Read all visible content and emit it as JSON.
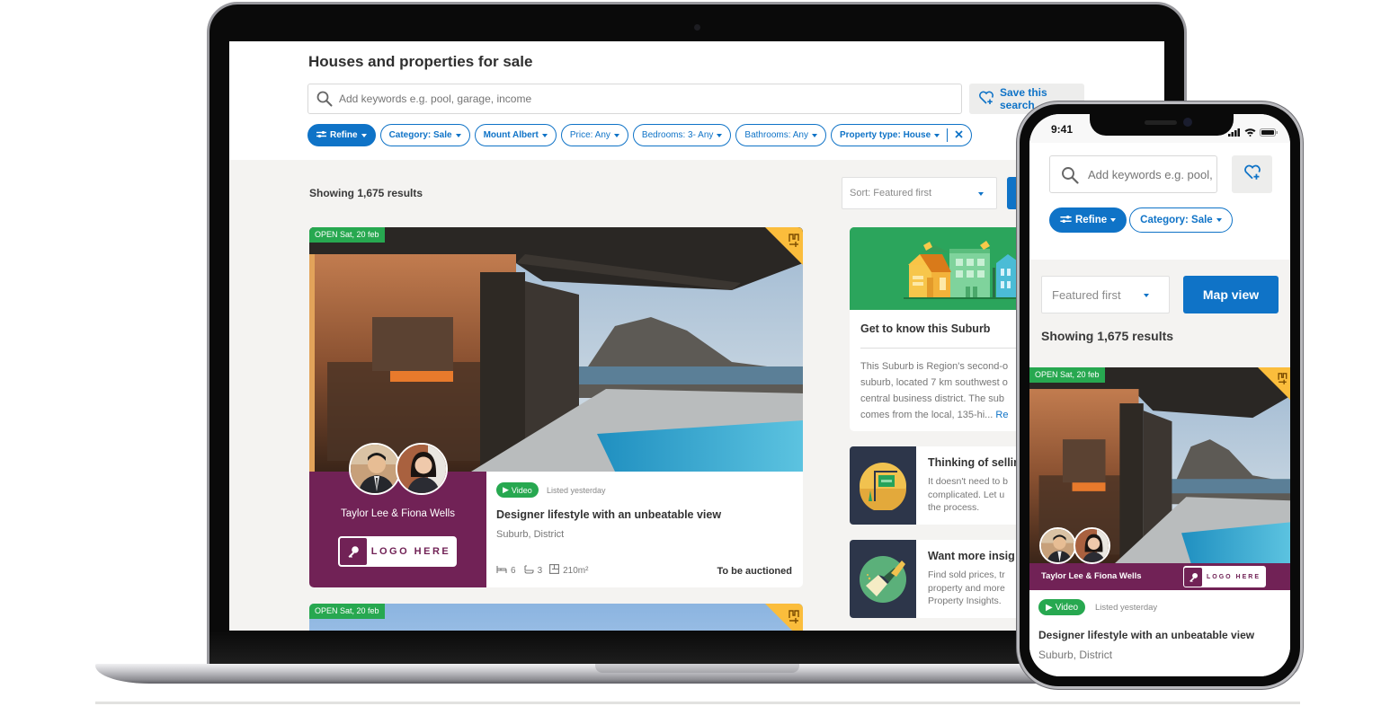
{
  "desktop": {
    "page_title": "Houses and properties for sale",
    "search": {
      "placeholder": "Add keywords e.g. pool, garage, income",
      "value": ""
    },
    "save_search_label": "Save this search",
    "filters": {
      "refine": "Refine",
      "category": "Category: Sale",
      "location": "Mount Albert",
      "price": "Price: Any",
      "bedrooms": "Bedrooms: 3- Any",
      "bathrooms": "Bathrooms: Any",
      "property_type": "Property type: House"
    },
    "results_count": "Showing 1,675 results",
    "sort": {
      "selected": "Sort: Featured first"
    },
    "listing": {
      "open_home": "OPEN Sat, 20 feb",
      "agent_names": "Taylor Lee & Fiona Wells",
      "agency_logo": "LOGO HERE",
      "video_badge": "Video",
      "listed": "Listed yesterday",
      "title": "Designer lifestyle with an unbeatable view",
      "location": "Suburb, District",
      "bedrooms": "6",
      "bathrooms": "3",
      "floor_area": "210m²",
      "sale_method": "To be auctioned"
    },
    "listing2": {
      "open_home": "OPEN Sat, 20 feb"
    },
    "suburb_card": {
      "title": "Get to know this Suburb",
      "lines": [
        "This Suburb is Region's second-o",
        "suburb, located 7 km southwest o",
        "central business district. The sub",
        "comes from the local, 135-hi... "
      ],
      "read_more": "Re"
    },
    "promos": [
      {
        "title": "Thinking of sellin",
        "lines": [
          "It doesn't need to b",
          "complicated. Let u",
          "the process."
        ]
      },
      {
        "title": "Want more insig",
        "lines": [
          "Find sold prices, tr",
          "property and more",
          "Property Insights."
        ]
      }
    ]
  },
  "mobile": {
    "status_time": "9:41",
    "search": {
      "placeholder": "Add keywords e.g. pool,",
      "value": ""
    },
    "filters": {
      "refine": "Refine",
      "category": "Category: Sale"
    },
    "sort": {
      "selected": "Featured first"
    },
    "map_view": "Map view",
    "results_count": "Showing 1,675 results",
    "listing": {
      "open_home": "OPEN Sat, 20 feb",
      "agent_names": "Taylor Lee & Fiona Wells",
      "agency_logo": "LOGO HERE",
      "video_badge": "Video",
      "listed": "Listed yesterday",
      "title": "Designer lifestyle with an unbeatable view",
      "location": "Suburb, District"
    }
  },
  "colors": {
    "brand_blue": "#0f73c7",
    "open_green": "#27a850",
    "agent_purple": "#712256",
    "watchlist_yellow": "#fbbd3c",
    "page_bg": "#f4f3f1"
  }
}
